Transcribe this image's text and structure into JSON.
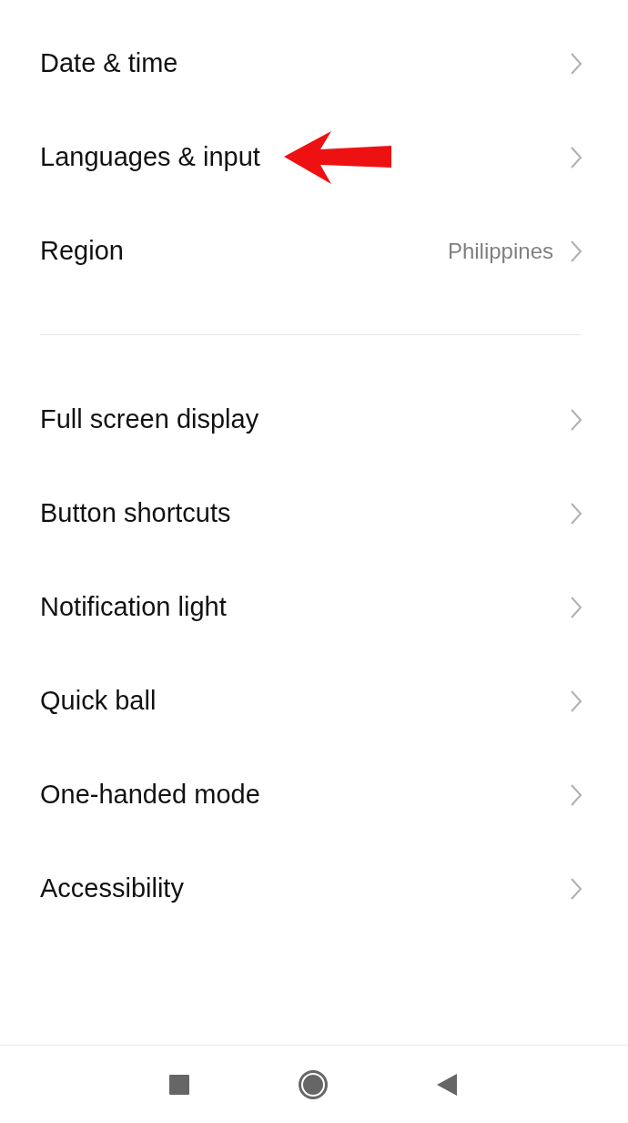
{
  "settings_groups": [
    {
      "items": [
        {
          "label": "Date & time",
          "annotated": false
        },
        {
          "label": "Languages & input",
          "annotated": true
        },
        {
          "label": "Region",
          "value": "Philippines",
          "annotated": false
        }
      ]
    },
    {
      "items": [
        {
          "label": "Full screen display",
          "annotated": false
        },
        {
          "label": "Button shortcuts",
          "annotated": false
        },
        {
          "label": "Notification light",
          "annotated": false
        },
        {
          "label": "Quick ball",
          "annotated": false
        },
        {
          "label": "One-handed mode",
          "annotated": false
        },
        {
          "label": "Accessibility",
          "annotated": false
        }
      ]
    }
  ]
}
